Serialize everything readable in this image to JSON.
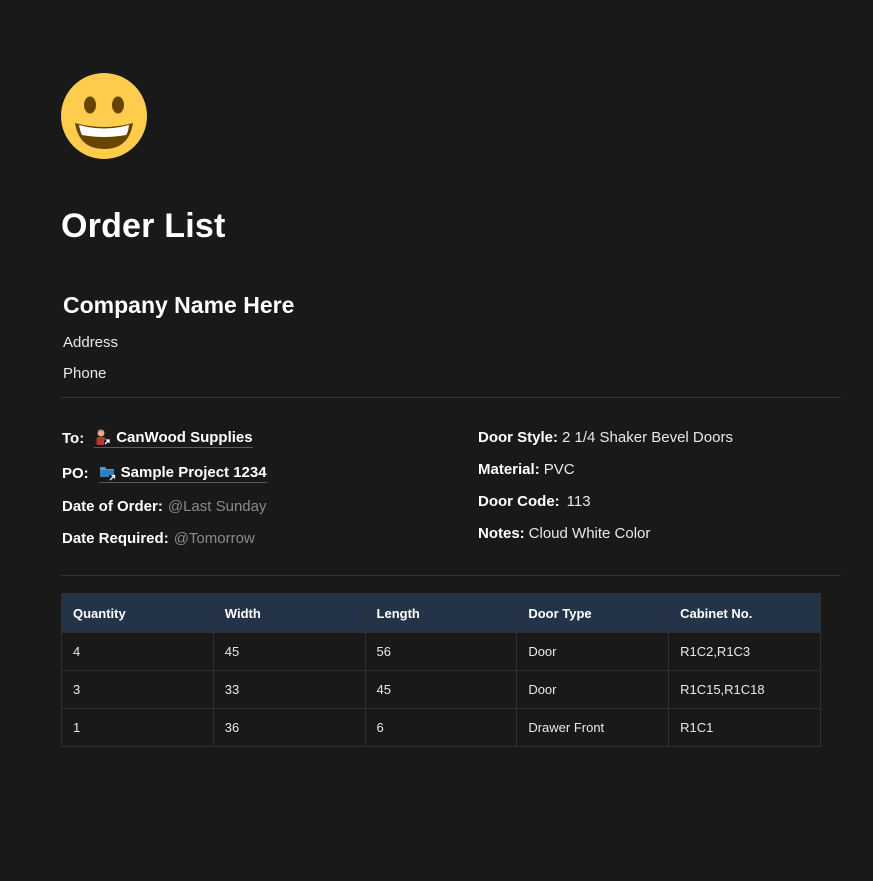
{
  "page": {
    "icon": "grinning-face-emoji",
    "title": "Order List"
  },
  "company": {
    "name": "Company Name Here",
    "address": "Address",
    "phone": "Phone"
  },
  "left_fields": {
    "to_label": "To:",
    "to_value": "CanWood Supplies",
    "to_icon": "supplier-page-link-icon",
    "po_label": "PO:",
    "po_value": "Sample Project 1234",
    "po_icon": "folder-page-link-icon",
    "date_order_label": "Date of Order:",
    "date_order_value": "@Last Sunday",
    "date_required_label": "Date Required:",
    "date_required_value": "@Tomorrow"
  },
  "right_fields": {
    "door_style_label": "Door Style:",
    "door_style_value": "2 1/4 Shaker Bevel Doors",
    "material_label": "Material:",
    "material_value": "PVC",
    "door_code_label": "Door Code:",
    "door_code_value": "113",
    "notes_label": "Notes:",
    "notes_value": "Cloud White Color"
  },
  "table": {
    "headers": [
      "Quantity",
      "Width",
      "Length",
      "Door Type",
      "Cabinet No."
    ],
    "rows": [
      [
        "4",
        "45",
        "56",
        "Door",
        "R1C2,R1C3"
      ],
      [
        "3",
        "33",
        "45",
        "Door",
        "R1C15,R1C18"
      ],
      [
        "1",
        "36",
        "6",
        "Drawer Front",
        "R1C1"
      ]
    ]
  },
  "colors": {
    "background": "#191919",
    "table_header": "#233449",
    "mention_text": "#8a8a86"
  }
}
